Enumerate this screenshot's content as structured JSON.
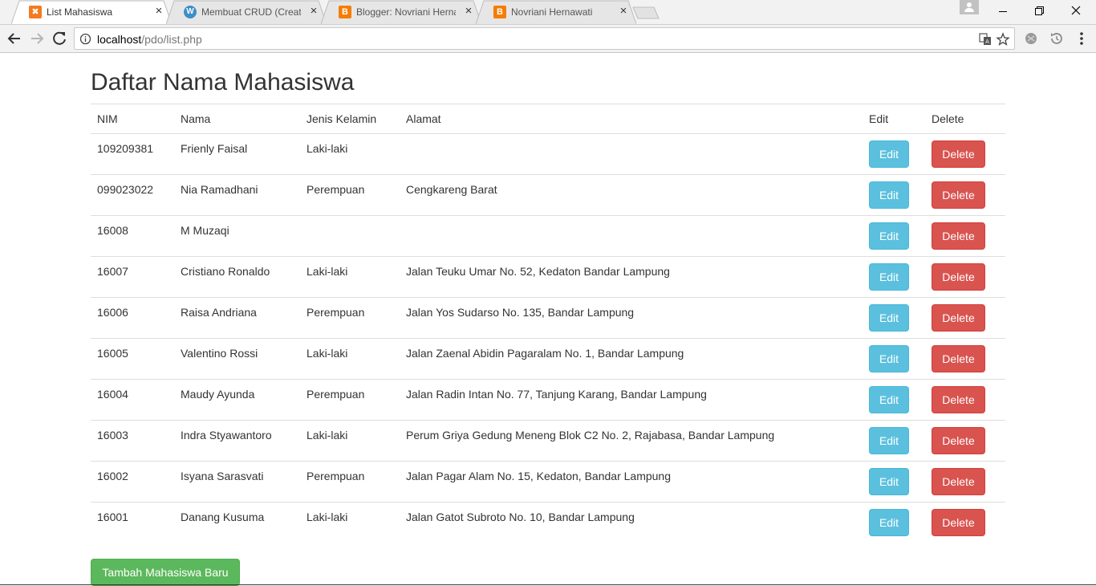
{
  "browser": {
    "tabs": [
      {
        "title": "List Mahasiswa",
        "favicon": "xampp-icon",
        "active": true
      },
      {
        "title": "Membuat CRUD (Create,",
        "favicon": "wordpress-icon",
        "active": false
      },
      {
        "title": "Blogger: Novriani Hernaw",
        "favicon": "blogger-icon",
        "active": false
      },
      {
        "title": "Novriani Hernawati",
        "favicon": "blogger-icon",
        "active": false
      }
    ],
    "url_host": "localhost",
    "url_path": "/pdo/list.php"
  },
  "page": {
    "title": "Daftar Nama Mahasiswa",
    "table": {
      "headers": {
        "nim": "NIM",
        "nama": "Nama",
        "jk": "Jenis Kelamin",
        "alamat": "Alamat",
        "edit": "Edit",
        "delete": "Delete"
      },
      "rows": [
        {
          "nim": "109209381",
          "nama": "Frienly Faisal",
          "jk": "Laki-laki",
          "alamat": ""
        },
        {
          "nim": "099023022",
          "nama": "Nia Ramadhani",
          "jk": "Perempuan",
          "alamat": "Cengkareng Barat"
        },
        {
          "nim": "16008",
          "nama": "M Muzaqi",
          "jk": "",
          "alamat": ""
        },
        {
          "nim": "16007",
          "nama": "Cristiano Ronaldo",
          "jk": "Laki-laki",
          "alamat": "Jalan Teuku Umar No. 52, Kedaton Bandar Lampung"
        },
        {
          "nim": "16006",
          "nama": "Raisa Andriana",
          "jk": "Perempuan",
          "alamat": "Jalan Yos Sudarso No. 135, Bandar Lampung"
        },
        {
          "nim": "16005",
          "nama": "Valentino Rossi",
          "jk": "Laki-laki",
          "alamat": "Jalan Zaenal Abidin Pagaralam No. 1, Bandar Lampung"
        },
        {
          "nim": "16004",
          "nama": "Maudy Ayunda",
          "jk": "Perempuan",
          "alamat": "Jalan Radin Intan No. 77, Tanjung Karang, Bandar Lampung"
        },
        {
          "nim": "16003",
          "nama": "Indra Styawantoro",
          "jk": "Laki-laki",
          "alamat": "Perum Griya Gedung Meneng Blok C2 No. 2, Rajabasa, Bandar Lampung"
        },
        {
          "nim": "16002",
          "nama": "Isyana Sarasvati",
          "jk": "Perempuan",
          "alamat": "Jalan Pagar Alam No. 15, Kedaton, Bandar Lampung"
        },
        {
          "nim": "16001",
          "nama": "Danang Kusuma",
          "jk": "Laki-laki",
          "alamat": "Jalan Gatot Subroto No. 10, Bandar Lampung"
        }
      ],
      "edit_label": "Edit",
      "delete_label": "Delete"
    },
    "add_button": "Tambah Mahasiswa Baru"
  },
  "colors": {
    "info": "#5bc0de",
    "danger": "#d9534f",
    "success": "#5cb85c"
  }
}
